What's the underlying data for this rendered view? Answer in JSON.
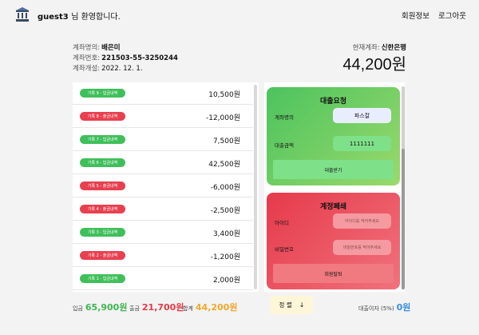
{
  "header": {
    "username": "guest3",
    "welcome_suffix": "님 환영합니다.",
    "nav_profile": "회원정보",
    "nav_logout": "로그아웃",
    "icon": "bank-icon"
  },
  "account": {
    "name_label": "계좌명의:",
    "name_value": "배은미",
    "number_label": "계좌번호:",
    "number_value": "221503-55-3250244",
    "opened_label": "계좌개설:",
    "opened_value": "2022. 12. 1.",
    "current_bank_label": "현재계좌:",
    "current_bank_value": "신한은행",
    "balance": "44,200원"
  },
  "transactions": [
    {
      "badge": "기록 9 - 입금내역",
      "type": "in",
      "amount": "10,500원"
    },
    {
      "badge": "기록 8 - 출금내역",
      "type": "out",
      "amount": "-12,000원"
    },
    {
      "badge": "기록 7 - 입금내역",
      "type": "in",
      "amount": "7,500원"
    },
    {
      "badge": "기록 6 - 입금내역",
      "type": "in",
      "amount": "42,500원"
    },
    {
      "badge": "기록 5 - 출금내역",
      "type": "out",
      "amount": "-6,000원"
    },
    {
      "badge": "기록 4 - 출금내역",
      "type": "out",
      "amount": "-2,500원"
    },
    {
      "badge": "기록 3 - 입금내역",
      "type": "in",
      "amount": "3,400원"
    },
    {
      "badge": "기록 2 - 출금내역",
      "type": "out",
      "amount": "-1,200원"
    },
    {
      "badge": "기록 1 - 입금내역",
      "type": "in",
      "amount": "2,000원"
    }
  ],
  "loan": {
    "title": "대출요청",
    "holder_label": "계좌명의",
    "holder_value": "파스칼",
    "amount_label": "대출금액",
    "amount_value": "1111111",
    "submit": "대출받기"
  },
  "close_account": {
    "title": "계정폐쇄",
    "id_label": "아이디",
    "id_placeholder": "아이디를 적어주세요",
    "pw_label": "비밀번호",
    "pw_placeholder": "비밀번호를 적어주세요",
    "submit": "회원탈퇴"
  },
  "footer": {
    "deposit_label": "입금",
    "deposit_value": "65,900원",
    "withdraw_label": "출금",
    "withdraw_value": "21,700원",
    "total_label": "합계",
    "total_value": "44,200원",
    "sort_label": "정 렬",
    "sort_icon": "arrow-down-icon",
    "interest_label": "대출이자 (5%)",
    "interest_value": "0원"
  },
  "colors": {
    "deposit": "#3fbf5a",
    "withdraw": "#e8404f",
    "total": "#f0a82c",
    "interest": "#3a8ee2"
  }
}
